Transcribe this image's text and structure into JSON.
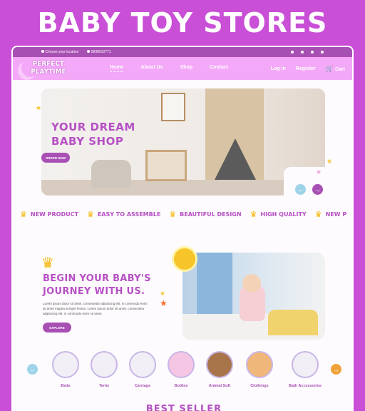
{
  "banner": {
    "title": "BABY TOY STORES"
  },
  "topbar": {
    "location": "Choose your location",
    "phone": "9998012771"
  },
  "header": {
    "logo_line1": "PERFECT",
    "logo_line2": "PLAYTIME",
    "nav": [
      "Home",
      "About Us",
      "Shop",
      "Contact"
    ],
    "login": "Log in",
    "register": "Register",
    "cart": "Cart"
  },
  "hero": {
    "title_line1": "YOUR DREAM",
    "title_line2": "BABY SHOP",
    "button": "ORDER NOW",
    "prev": "←",
    "next": "→"
  },
  "ticker": [
    "NEW PRODUCT",
    "EASY TO ASSEMBLE",
    "BEAUTIFUL DESIGN",
    "HIGH QUALITY",
    "NEW P"
  ],
  "journey": {
    "title_line1": "BEGIN YOUR BABY'S",
    "title_line2": "JOURNEY WITH US.",
    "text": "Lorem ipsum dolor sit amet, consectetur adipiscing elit. In commodo enim sit amet magna semper lectus. Lorem ipsum dolor sit amet, consectetur adipiscing elit. In commodo enim sit amet.",
    "button": "EXPLORE"
  },
  "categories": [
    {
      "label": "Beds"
    },
    {
      "label": "Tents"
    },
    {
      "label": "Carriage"
    },
    {
      "label": "Bottles"
    },
    {
      "label": "Animal Soft"
    },
    {
      "label": "Clothings"
    },
    {
      "label": "Bath Accessories"
    }
  ],
  "best_seller": {
    "title": "BEST SELLER"
  },
  "colors": {
    "brand": "#b650c4",
    "background": "#c94fd6",
    "nav": "#f4a8f8",
    "accent": "#f4b400"
  }
}
